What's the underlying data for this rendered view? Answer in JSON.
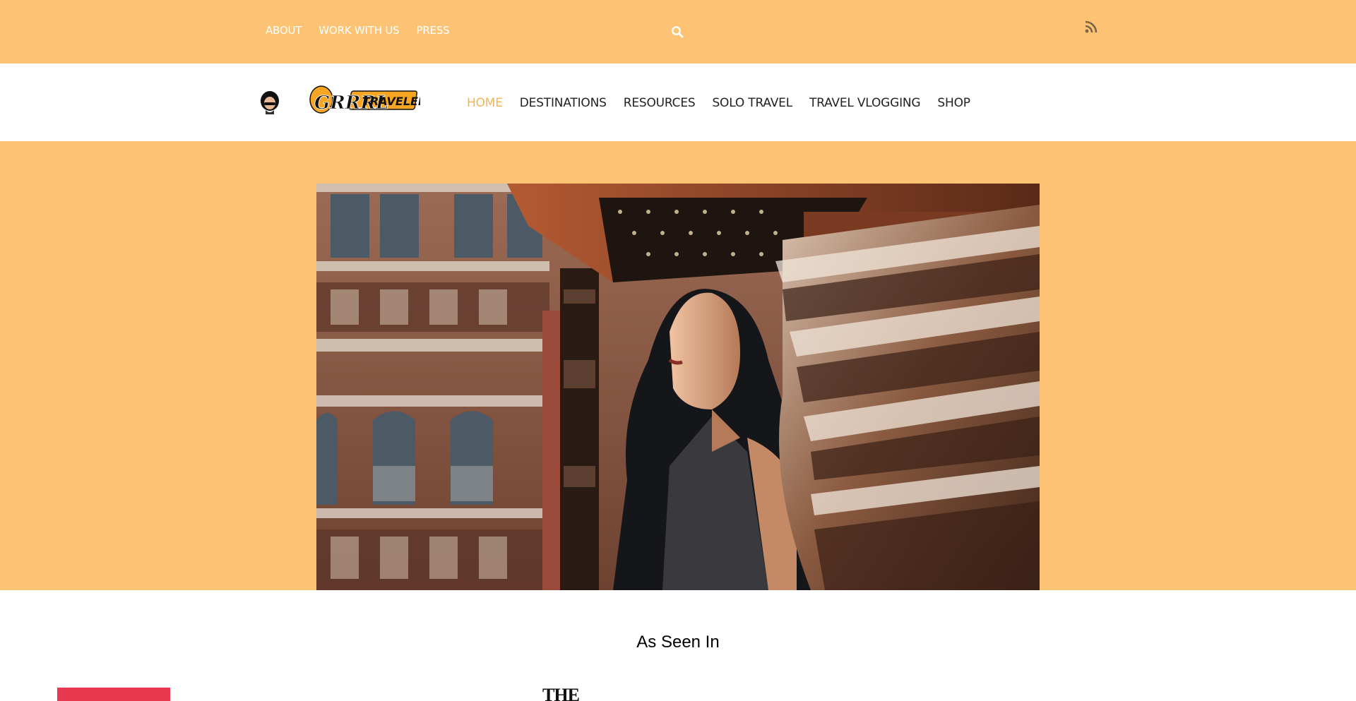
{
  "topbar": {
    "links": [
      "ABOUT",
      "WORK WITH US",
      "PRESS"
    ],
    "search_icon": "search-icon",
    "rss_icon": "rss-icon",
    "bg_color": "#fdc374"
  },
  "header": {
    "logo_text_1": "GRRRL",
    "logo_text_2": "TRAVELER",
    "nav": [
      "HOME",
      "DESTINATIONS",
      "RESOURCES",
      "SOLO TRAVEL",
      "TRAVEL VLOGGING",
      "SHOP"
    ],
    "active_nav": "HOME",
    "active_color": "#f4b356"
  },
  "hero": {
    "image": "woman smiling in ornate carved wooden courtyard"
  },
  "press": {
    "heading": "As Seen In",
    "logo_text_the": "THE"
  }
}
